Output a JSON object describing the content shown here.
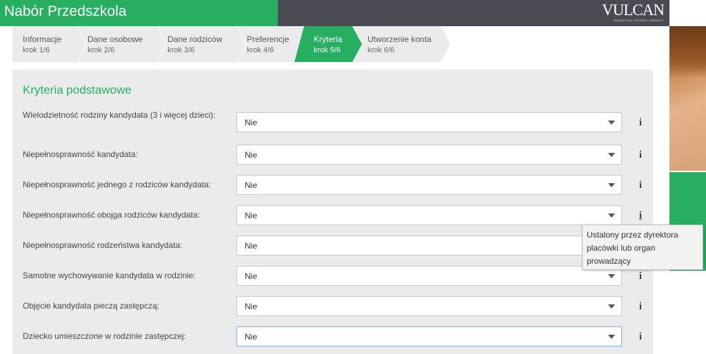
{
  "header": {
    "title": "Nabór Przedszkola",
    "logo_text": "VULCAN",
    "logo_tagline": "RAZEM DLA LEPSZEJ OŚWIATY"
  },
  "steps": [
    {
      "name": "Informacje",
      "sub": "krok 1/6",
      "active": false
    },
    {
      "name": "Dane osobowe",
      "sub": "krok 2/6",
      "active": false
    },
    {
      "name": "Dane rodziców",
      "sub": "krok 3/6",
      "active": false
    },
    {
      "name": "Preferencje",
      "sub": "krok 4/6",
      "active": false
    },
    {
      "name": "Kryteria",
      "sub": "krok 5/6",
      "active": true
    },
    {
      "name": "Utworzenie konta",
      "sub": "krok 6/6",
      "active": false
    }
  ],
  "section": {
    "title": "Kryteria podstawowe"
  },
  "criteria": [
    {
      "label": "Wielodzietność rodziny kandydata (3 i więcej dzieci):",
      "value": "Nie"
    },
    {
      "label": "Niepełnosprawność kandydata:",
      "value": "Nie"
    },
    {
      "label": "Niepełnosprawność jednego z rodziców kandydata:",
      "value": "Nie"
    },
    {
      "label": "Niepełnosprawność obojga rodziców kandydata:",
      "value": "Nie"
    },
    {
      "label": "Niepełnosprawność rodzeństwa kandydata:",
      "value": "Nie"
    },
    {
      "label": "Samotne wychowywanie kandydata w rodzinie:",
      "value": "Nie"
    },
    {
      "label": "Objęcie kandydata pieczą zastępczą:",
      "value": "Nie"
    },
    {
      "label": "Dziecko umieszczone w rodzinie zastępczej:",
      "value": "Nie"
    }
  ],
  "info_symbol": "i",
  "tooltip": {
    "text": "Ustalony przez dyrektora placówki lub organ prowadzący"
  },
  "colors": {
    "brand_green": "#27ae60",
    "header_dark": "#4a4a52",
    "step_bg": "#ebebeb",
    "panel_bg": "#ebebeb"
  }
}
